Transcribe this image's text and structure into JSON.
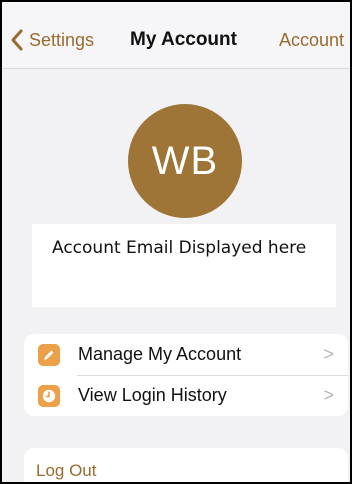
{
  "navbar": {
    "back_label": "Settings",
    "title": "My Account",
    "right_label": "Account"
  },
  "profile": {
    "initials": "WB",
    "email_text": "Account Email Displayed here"
  },
  "menu": {
    "items": [
      {
        "label": "Manage My Account",
        "icon": "pencil-icon",
        "chevron": ">"
      },
      {
        "label": "View Login History",
        "icon": "clock-icon",
        "chevron": ">"
      }
    ]
  },
  "logout": {
    "label": "Log Out"
  },
  "colors": {
    "accent": "#9a6b2e",
    "avatar": "#9e7536",
    "icon_bg": "#eda04a",
    "background": "#f2f2f5"
  }
}
